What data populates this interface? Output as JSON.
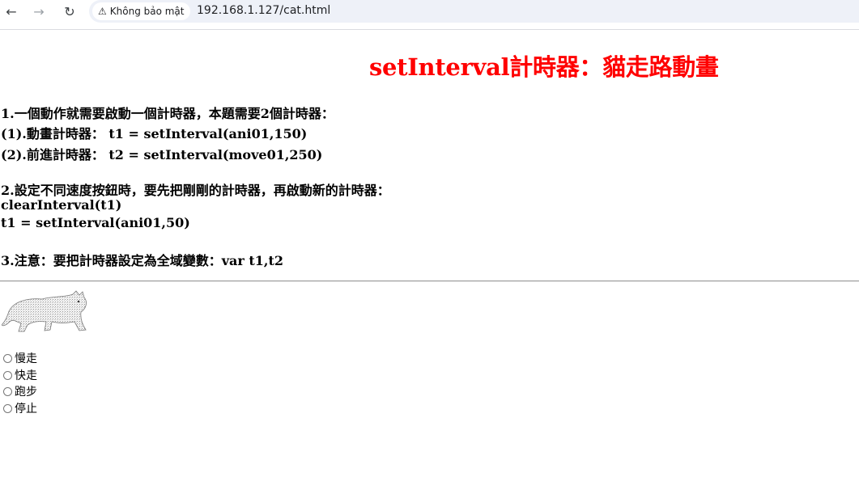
{
  "browser": {
    "security_label": "Không bảo mật",
    "url": "192.168.1.127/cat.html"
  },
  "page": {
    "title": "setInterval計時器：貓走路動畫",
    "lines": [
      "1.一個動作就需要啟動一個計時器，本題需要2個計時器：",
      "(1).動畫計時器：  t1 = setInterval(ani01,150)",
      "(2).前進計時器：  t2 = setInterval(move01,250)",
      "2.設定不同速度按鈕時，要先把剛剛的計時器，再啟動新的計時器：",
      "clearInterval(t1)",
      "t1 = setInterval(ani01,50)",
      "3.注意：要把計時器設定為全域變數：var t1,t2"
    ],
    "speed_options": [
      "慢走",
      "快走",
      "跑步",
      "停止"
    ]
  }
}
